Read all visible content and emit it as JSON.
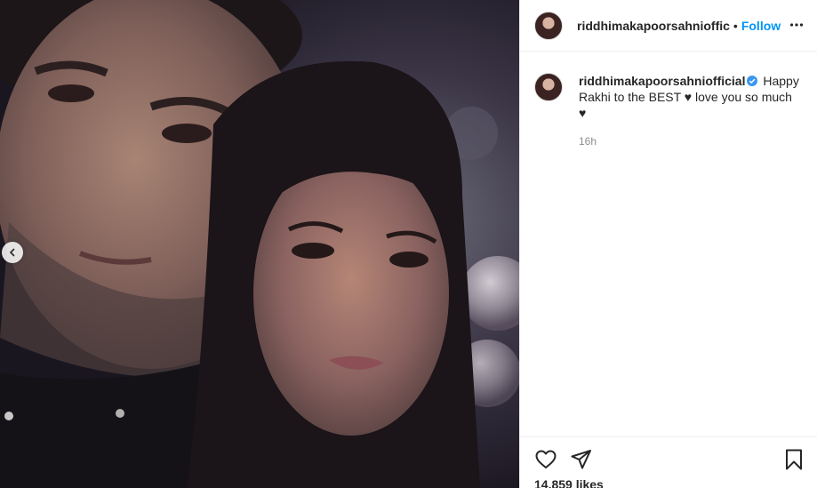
{
  "post": {
    "username": "riddhimakapoorsahnioffic",
    "header_separator": "•",
    "follow_label": "Follow",
    "caption": {
      "username": "riddhimakapoorsahniofficial",
      "text_line1": "Happy",
      "text_line2": "Rakhi to the BEST ♥ love you so much",
      "text_line3": "♥"
    },
    "time_ago": "16h",
    "likes": "14,859 likes"
  },
  "icons": {
    "more": "more-options-icon",
    "verified": "verified-badge-icon",
    "like": "heart-icon",
    "share": "paper-plane-icon",
    "save": "bookmark-icon",
    "carousel_prev": "chevron-left-icon"
  },
  "colors": {
    "follow": "#0095f6",
    "verified": "#3897f0",
    "muted_text": "#8e8e8e"
  }
}
